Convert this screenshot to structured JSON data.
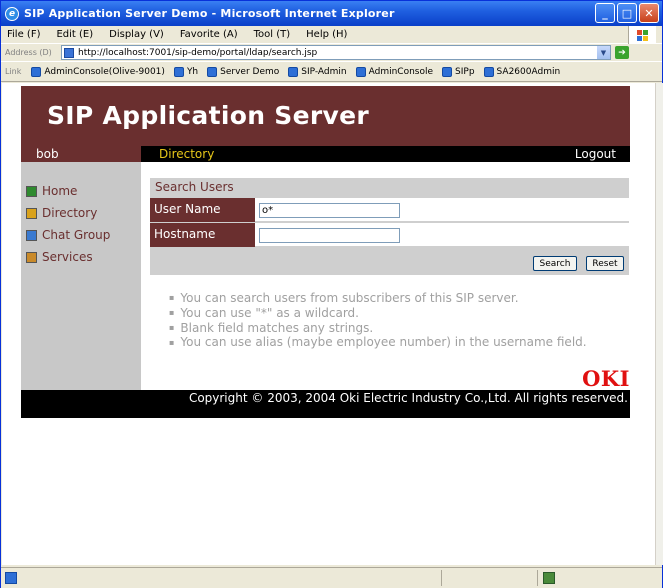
{
  "window": {
    "title": "SIP Application Server Demo - Microsoft Internet Explorer"
  },
  "menu": [
    "File (F)",
    "Edit (E)",
    "Display (V)",
    "Favorite (A)",
    "Tool (T)",
    "Help (H)"
  ],
  "address": {
    "label": "Address (D)",
    "url": "http://localhost:7001/sip-demo/portal/ldap/search.jsp"
  },
  "links": {
    "label": "Link",
    "items": [
      "AdminConsole(Olive-9001)",
      "Yh",
      "Server Demo",
      "SIP-Admin",
      "AdminConsole",
      "SIPp",
      "SA2600Admin"
    ]
  },
  "page": {
    "banner_title": "SIP Application Server",
    "user": "bob",
    "section": "Directory",
    "logout": "Logout",
    "sidebar": [
      {
        "label": "Home",
        "icon": "home-icon"
      },
      {
        "label": "Directory",
        "icon": "directory-icon"
      },
      {
        "label": "Chat Group",
        "icon": "chat-group-icon"
      },
      {
        "label": "Services",
        "icon": "services-icon"
      }
    ],
    "search": {
      "title": "Search Users",
      "user_name_label": "User Name",
      "user_name_value": "o*",
      "hostname_label": "Hostname",
      "hostname_value": "",
      "search_button": "Search",
      "reset_button": "Reset"
    },
    "tips": [
      "You can search users from subscribers of this SIP server.",
      "You can use \"*\" as a wildcard.",
      "Blank field matches any strings.",
      "You can use alias (maybe employee number) in the username field."
    ],
    "logo": "OKI",
    "copyright": "Copyright © 2003, 2004 Oki Electric Industry Co.,Ltd. All rights reserved."
  },
  "colors": {
    "brand": "#6a2f2f",
    "nav_highlight": "#e6c619",
    "logo_red": "#e01010"
  }
}
